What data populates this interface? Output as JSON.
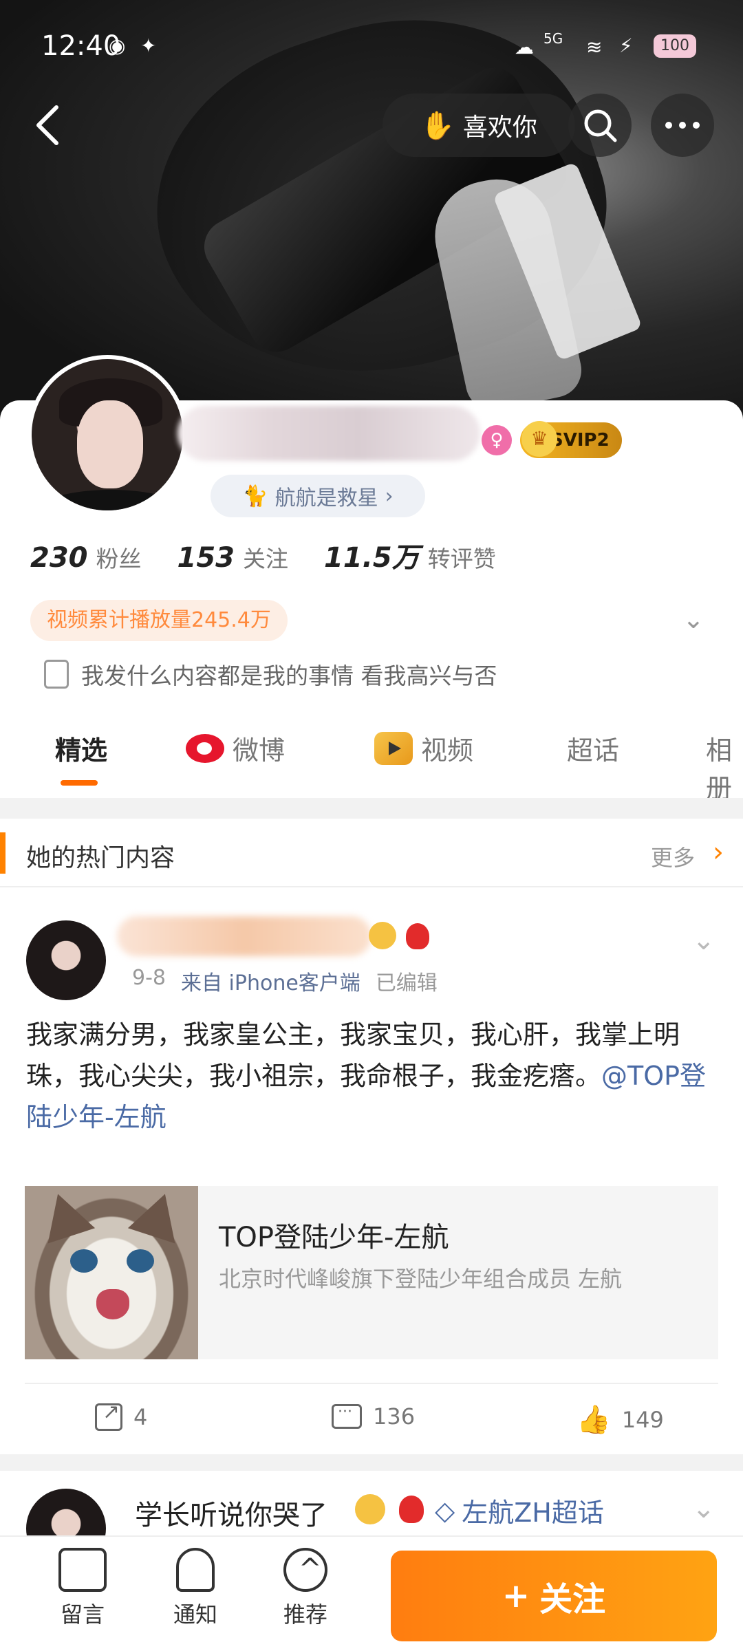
{
  "status_bar": {
    "time": "12:40",
    "network": "5G",
    "battery": "100"
  },
  "header": {
    "like_label": "喜欢你"
  },
  "profile": {
    "fan_group": "航航是救星",
    "stats": [
      {
        "value": "230",
        "label": "粉丝"
      },
      {
        "value": "153",
        "label": "关注"
      },
      {
        "value": "11.5万",
        "label": "转评赞"
      }
    ],
    "play_count": "视频累计播放量245.4万",
    "bio": "我发什么内容都是我的事情 看我高兴与否",
    "vip_badge": "SVIP2"
  },
  "tabs": [
    {
      "label": "精选"
    },
    {
      "label": "微博"
    },
    {
      "label": "视频"
    },
    {
      "label": "超话"
    },
    {
      "label": "相册"
    }
  ],
  "hot_section": {
    "title": "她的热门内容",
    "more": "更多"
  },
  "post": {
    "date": "9-8",
    "source": "来自 iPhone客户端",
    "edited": "已编辑",
    "text": "我家满分男，我家皇公主，我家宝贝，我心肝，我掌上明珠，我心尖尖，我小祖宗，我命根子，我金疙瘩。",
    "mention": "@TOP登陆少年-左航",
    "link_card": {
      "title": "TOP登陆少年-左航",
      "subtitle": "北京时代峰峻旗下登陆少年组合成员 左航"
    },
    "reposts": "4",
    "comments": "136",
    "likes": "149"
  },
  "next_post": {
    "name": "学长听说你哭了",
    "topic": "左航ZH超话"
  },
  "bottom_bar": {
    "message": "留言",
    "notify": "通知",
    "recommend": "推荐",
    "follow": "关注"
  },
  "colors": {
    "accent": "#ff8200",
    "link": "#4a6aa5"
  }
}
